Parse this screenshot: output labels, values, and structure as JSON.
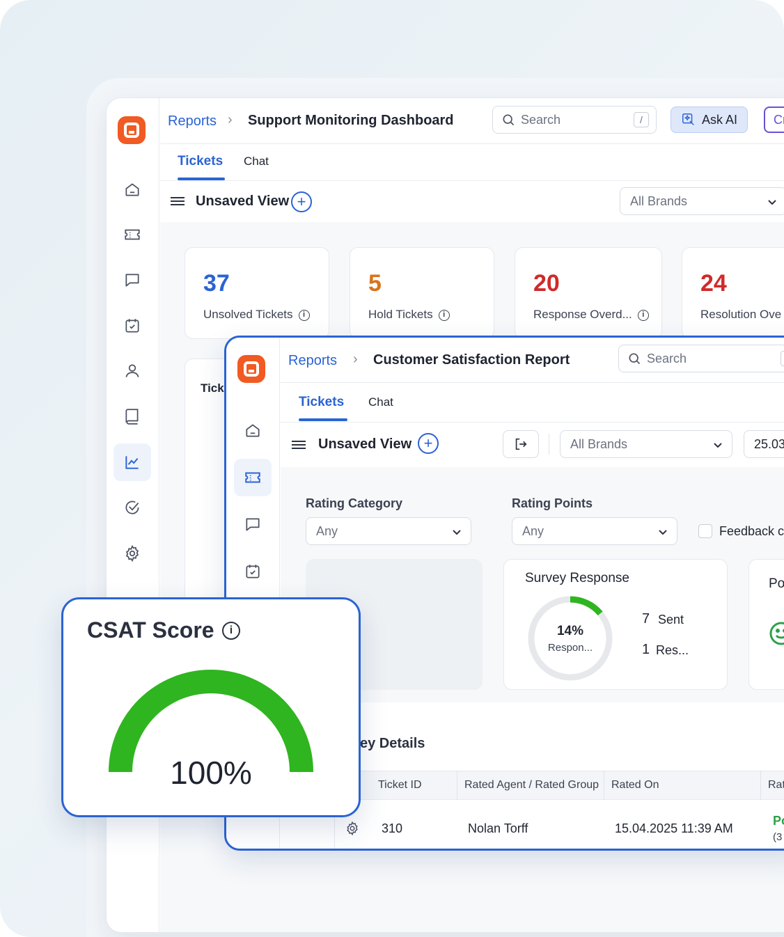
{
  "app": {
    "breadcrumb_root": "Reports",
    "dashboard_title": "Support Monitoring Dashboard",
    "search_placeholder": "Search",
    "search_shortcut": "/",
    "ask_ai_label": "Ask AI",
    "create_label": "Cr",
    "tabs": [
      "Tickets",
      "Chat"
    ],
    "view_label": "Unsaved View",
    "brand_select": "All Brands",
    "stats": [
      {
        "value": "37",
        "label": "Unsolved Tickets",
        "color": "#2a63d4"
      },
      {
        "value": "5",
        "label": "Hold Tickets",
        "color": "#d9731a"
      },
      {
        "value": "20",
        "label": "Response Overd...",
        "color": "#d02a2a"
      },
      {
        "value": "24",
        "label": "Resolution Ove",
        "color": "#d02a2a"
      }
    ],
    "tickets_card_label": "Tick"
  },
  "report": {
    "breadcrumb_root": "Reports",
    "title": "Customer Satisfaction Report",
    "search_placeholder": "Search",
    "search_shortcut": "/",
    "tabs": [
      "Tickets",
      "Chat"
    ],
    "view_label": "Unsaved View",
    "brand_select": "All Brands",
    "date_value": "25.03",
    "filters": {
      "rating_category_label": "Rating Category",
      "rating_category_value": "Any",
      "rating_points_label": "Rating Points",
      "rating_points_value": "Any",
      "feedback_label": "Feedback c"
    },
    "survey": {
      "title": "Survey Response",
      "percent": "14%",
      "percent_label": "Respon...",
      "percent_value": 0.14,
      "sent_count": "7",
      "sent_label": "Sent",
      "responses_count": "1",
      "responses_label": "Res..."
    },
    "positive_panel_label": "Po",
    "details_title": "ey Details",
    "table": {
      "headers": [
        "Ticket ID",
        "Rated Agent / Rated Group",
        "Rated On",
        "Rat"
      ],
      "row": {
        "ticket_id": "310",
        "agent": "Nolan Torff",
        "rated_on": "15.04.2025 11:39 AM",
        "rating": "Po",
        "rating_sub": "(3"
      }
    }
  },
  "csat": {
    "title": "CSAT Score",
    "value": "100%",
    "fraction": 1.0,
    "gauge_color": "#2fb51f"
  }
}
